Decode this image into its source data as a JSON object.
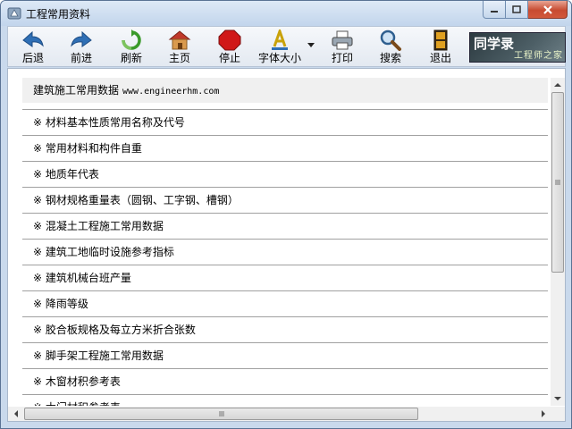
{
  "window": {
    "title": "工程常用资料"
  },
  "toolbar": {
    "back_label": "后退",
    "forward_label": "前进",
    "refresh_label": "刷新",
    "home_label": "主页",
    "stop_label": "停止",
    "fontsize_label": "字体大小",
    "print_label": "打印",
    "search_label": "搜索",
    "exit_label": "退出"
  },
  "logo": {
    "main_text": "同学录",
    "sub_text": "工程师之家"
  },
  "content": {
    "header_title": "建筑施工常用数据",
    "header_url": "www.engineerhm.com",
    "items": [
      "※ 材料基本性质常用名称及代号",
      "※ 常用材料和构件自重",
      "※ 地质年代表",
      "※ 钢材规格重量表（圆钢、工字钢、槽钢）",
      "※ 混凝土工程施工常用数据",
      "※ 建筑工地临时设施参考指标",
      "※ 建筑机械台班产量",
      "※ 降雨等级",
      "※ 胶合板规格及每立方米折合张数",
      "※ 脚手架工程施工常用数据",
      "※ 木窗材积参考表",
      "※ 木门材积参考表"
    ]
  },
  "scroll": {
    "vertical_fraction": 0.0
  },
  "colors": {
    "close_button": "#c74b31",
    "stop_icon": "#d01818",
    "home_icon": "#b8702a",
    "refresh_icon": "#3a9a2a",
    "arrow_icon": "#2f6fb5"
  }
}
